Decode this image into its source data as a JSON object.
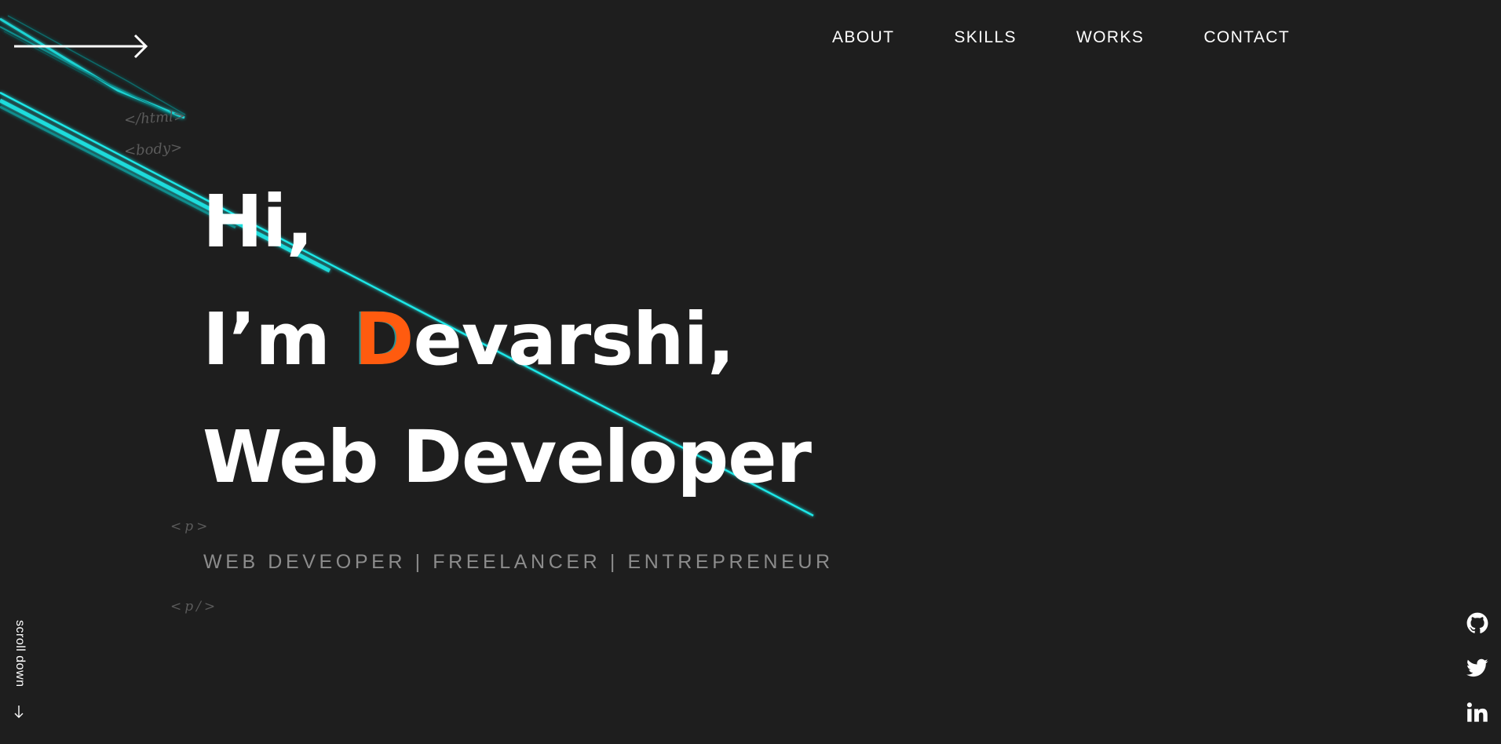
{
  "nav": {
    "items": [
      {
        "label": "ABOUT"
      },
      {
        "label": "SKILLS"
      },
      {
        "label": "WORKS"
      },
      {
        "label": "CONTACT"
      }
    ]
  },
  "decor": {
    "tag_html": "</html>",
    "tag_body": "<body>",
    "tag_p_open": "<p>",
    "tag_p_close": "<p/>"
  },
  "hero": {
    "line1": "Hi,",
    "line2_prefix": "I’m ",
    "line2_accent": "D",
    "line2_rest": "evarshi,",
    "line3": "Web Developer"
  },
  "subtitle": "WEB DEVEOPER | FREELANCER | ENTREPRENEUR",
  "scroll": {
    "label": "scroll down",
    "arrow_icon": "arrow-down-icon"
  },
  "menu": {
    "icon": "arrow-right-icon"
  },
  "socials": [
    {
      "icon": "github-icon"
    },
    {
      "icon": "twitter-icon"
    },
    {
      "icon": "linkedin-icon"
    }
  ],
  "colors": {
    "background": "#1e1e1e",
    "accent": "#ff5b0f",
    "laser": "#1ee8e8",
    "muted_text": "#8c8c8c",
    "tag_text": "#5b5b5b"
  }
}
